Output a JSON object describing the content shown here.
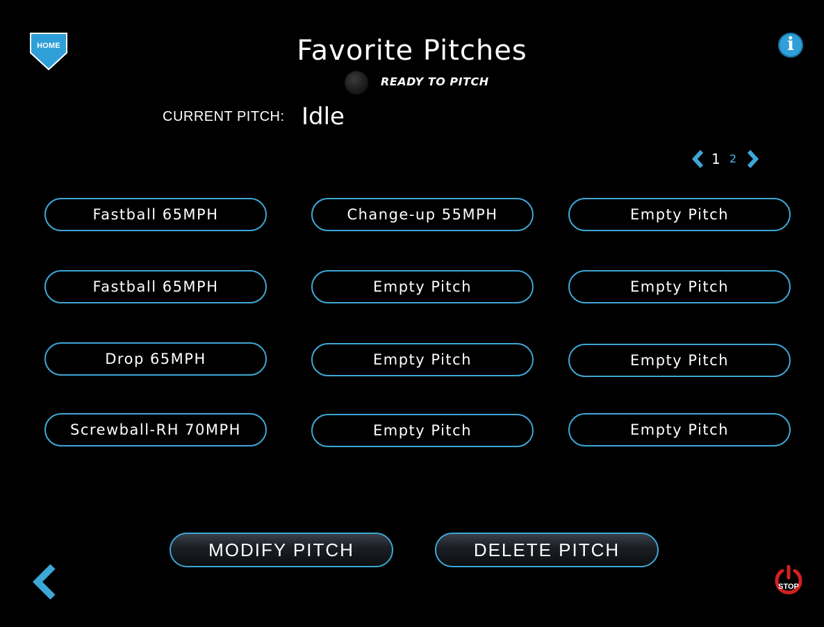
{
  "header": {
    "home_label": "HOME",
    "title": "Favorite Pitches",
    "info_label": "i",
    "status_text": "READY TO PITCH"
  },
  "current_pitch": {
    "label": "CURRENT PITCH:",
    "value": "Idle"
  },
  "pagination": {
    "current_page": "1",
    "next_page": "2"
  },
  "pitches": [
    [
      "Fastball 65MPH",
      "Change-up 55MPH",
      "Empty Pitch"
    ],
    [
      "Fastball 65MPH",
      "Empty Pitch",
      "Empty Pitch"
    ],
    [
      "Drop 65MPH",
      "Empty Pitch",
      "Empty Pitch"
    ],
    [
      "Screwball-RH 70MPH",
      "Empty Pitch",
      "Empty Pitch"
    ]
  ],
  "actions": {
    "modify_label": "MODIFY PITCH",
    "delete_label": "DELETE PITCH",
    "stop_label": "STOP"
  },
  "colors": {
    "accent": "#3da7d6",
    "info": "#2f9fd8",
    "stop": "#d42020",
    "background": "#000000"
  }
}
